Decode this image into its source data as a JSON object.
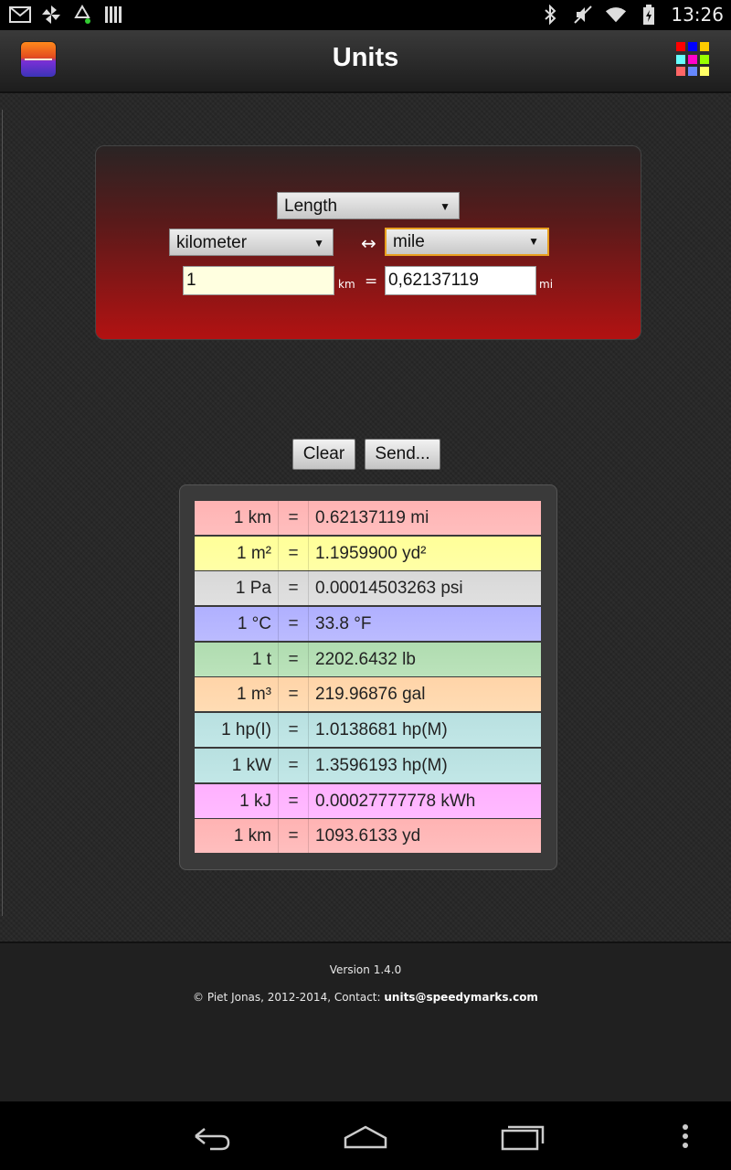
{
  "status_bar": {
    "left_icons": [
      "gmail-icon",
      "pinwheel-icon",
      "recycle-icon",
      "barcode-icon"
    ],
    "right_icons": [
      "bluetooth-icon",
      "mute-icon",
      "wifi-icon",
      "battery-icon"
    ],
    "time": "13:26"
  },
  "action_bar": {
    "title": "Units",
    "grid_colors": [
      "#ff0000",
      "#0000ff",
      "#ffcc00",
      "#66ffff",
      "#ff00cc",
      "#99ff00",
      "#ff6666",
      "#6688ff",
      "#ffff66"
    ]
  },
  "converter": {
    "category": "Length",
    "from_unit": "kilometer",
    "to_unit": "mile",
    "swap_symbol": "↔",
    "from_value": "1",
    "from_symbol": "km",
    "equals": "=",
    "to_value": "0,62137119",
    "to_symbol": "mi"
  },
  "buttons": {
    "clear": "Clear",
    "send": "Send..."
  },
  "results": [
    {
      "left": "1 km",
      "eq": "=",
      "right": "0.62137119 mi",
      "color": "#ffb3b3"
    },
    {
      "left": "1 m²",
      "eq": "=",
      "right": "1.1959900 yd²",
      "color": "#ffff99"
    },
    {
      "left": "1 Pa",
      "eq": "=",
      "right": "0.00014503263 psi",
      "color": "#d8d8d8"
    },
    {
      "left": "1 °C",
      "eq": "=",
      "right": "33.8 °F",
      "color": "#b0b0ff"
    },
    {
      "left": "1 t",
      "eq": "=",
      "right": "2202.6432 lb",
      "color": "#b0dcb0"
    },
    {
      "left": "1 m³",
      "eq": "=",
      "right": "219.96876 gal",
      "color": "#ffd4a8"
    },
    {
      "left": "1 hp(I)",
      "eq": "=",
      "right": "1.0138681 hp(M)",
      "color": "#b8e0e0"
    },
    {
      "left": "1 kW",
      "eq": "=",
      "right": "1.3596193 hp(M)",
      "color": "#b8e0e0"
    },
    {
      "left": "1 kJ",
      "eq": "=",
      "right": "0.00027777778 kWh",
      "color": "#ffb0ff"
    },
    {
      "left": "1 km",
      "eq": "=",
      "right": "1093.6133 yd",
      "color": "#ffb3b3"
    }
  ],
  "footer": {
    "version": "Version 1.4.0",
    "copyright_prefix": "© Piet Jonas, 2012-2014, Contact: ",
    "email": "units@speedymarks.com"
  },
  "nav_bar": {
    "buttons": [
      "back-icon",
      "home-icon",
      "recents-icon",
      "overflow-menu-icon"
    ]
  }
}
